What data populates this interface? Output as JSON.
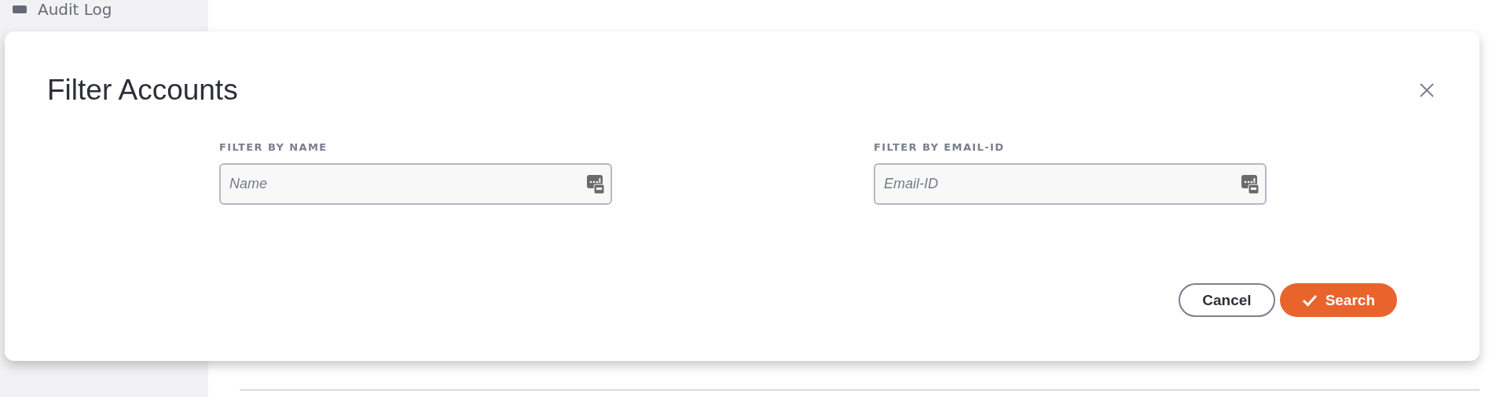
{
  "sidebar": {
    "items": [
      {
        "label": "Audit Log"
      }
    ]
  },
  "dialog": {
    "title": "Filter Accounts",
    "fields": [
      {
        "label": "FILTER BY NAME",
        "placeholder": "Name"
      },
      {
        "label": "FILTER BY EMAIL-ID",
        "placeholder": "Email-ID"
      }
    ],
    "buttons": [
      {
        "kind": "secondary",
        "label": "Cancel"
      },
      {
        "kind": "primary",
        "label": "Search"
      }
    ]
  }
}
